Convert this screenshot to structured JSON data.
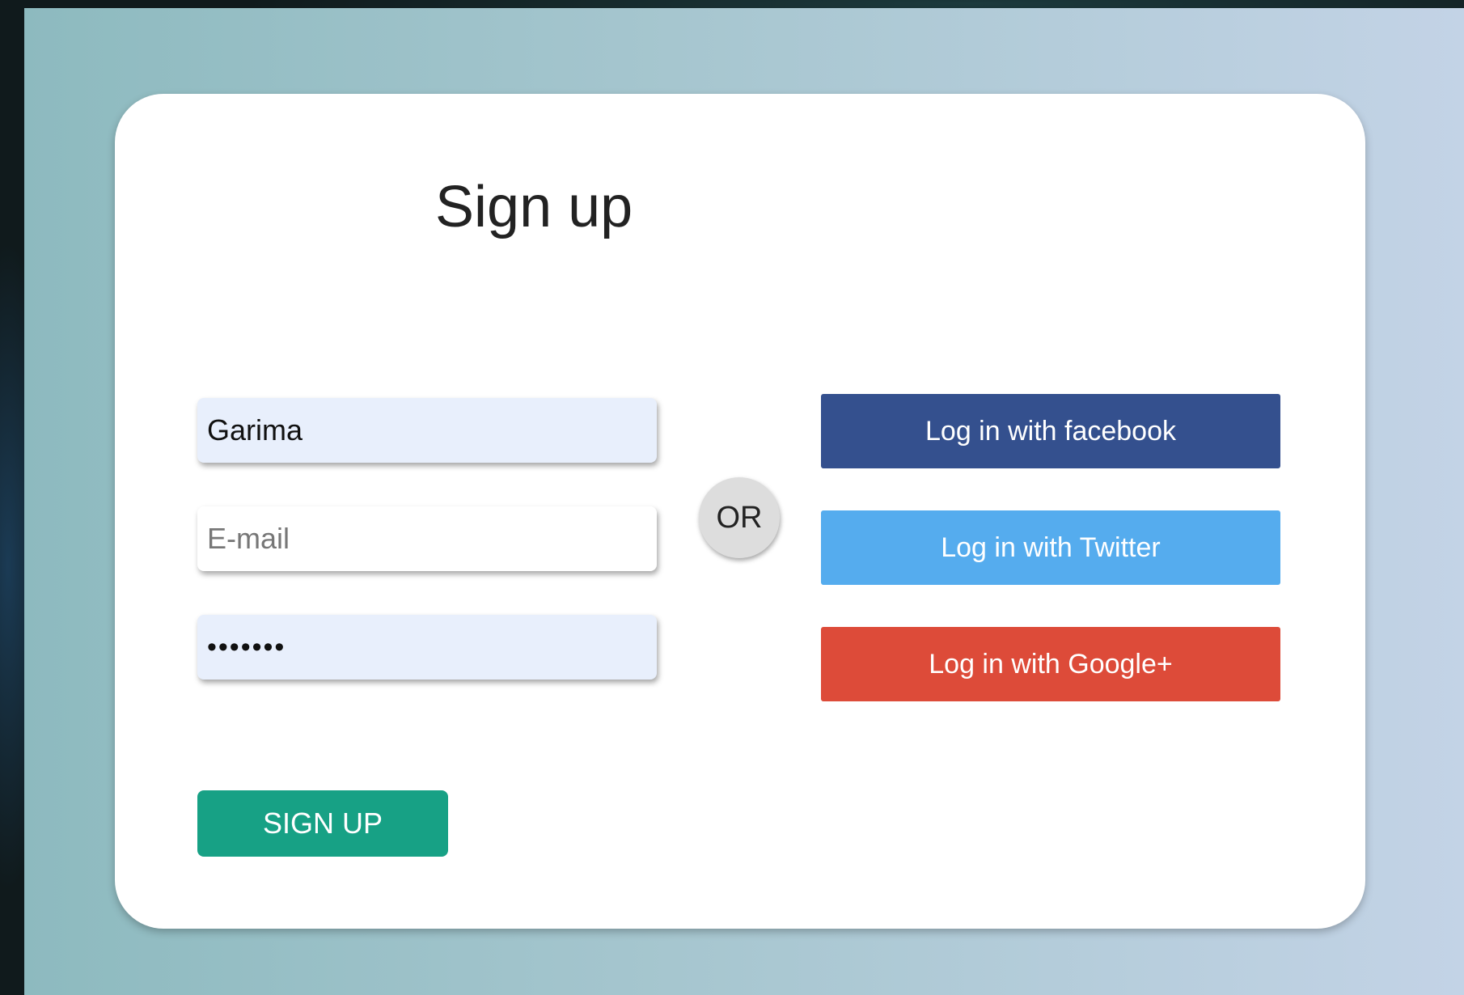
{
  "form": {
    "title": "Sign up",
    "name_value": "Garima",
    "email_placeholder": "E-mail",
    "password_value": "•••••••",
    "submit_label": "SIGN UP"
  },
  "divider": {
    "label": "OR"
  },
  "social": {
    "facebook_label": "Log in with facebook",
    "twitter_label": "Log in with Twitter",
    "google_label": "Log in with Google+"
  },
  "colors": {
    "facebook": "#34508e",
    "twitter": "#55acee",
    "google": "#dd4b39",
    "signup": "#17a185",
    "autofill": "#e8effc"
  }
}
